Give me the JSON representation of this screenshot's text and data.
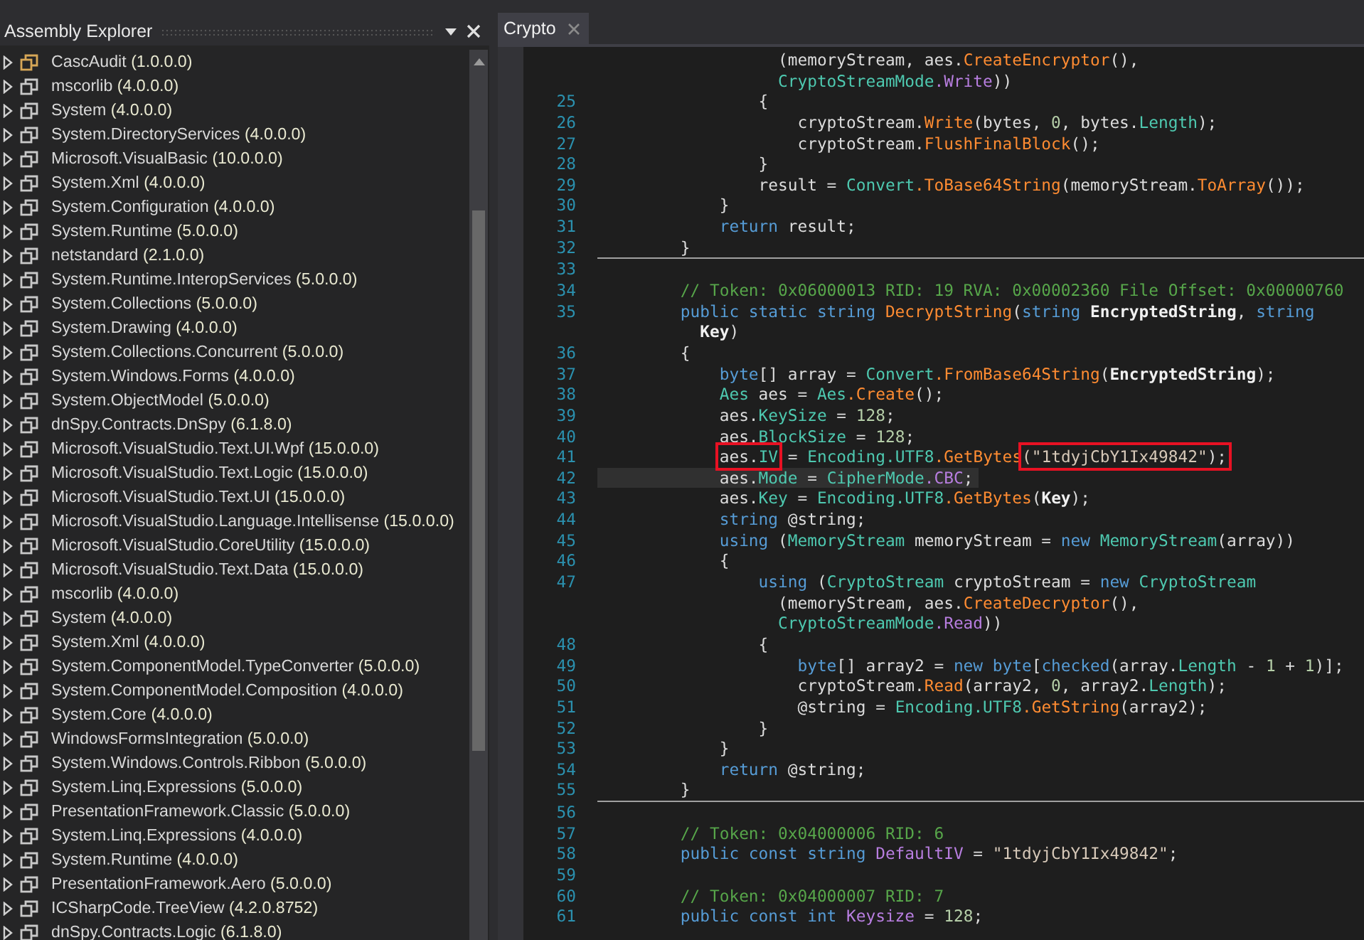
{
  "explorer": {
    "title": "Assembly Explorer",
    "items": [
      {
        "name": "CascAudit",
        "version": "(1.0.0.0)",
        "color": "#d7a757"
      },
      {
        "name": "mscorlib",
        "version": "(4.0.0.0)",
        "color": "#c8c8c8"
      },
      {
        "name": "System",
        "version": "(4.0.0.0)",
        "color": "#c8c8c8"
      },
      {
        "name": "System.DirectoryServices",
        "version": "(4.0.0.0)",
        "color": "#c8c8c8"
      },
      {
        "name": "Microsoft.VisualBasic",
        "version": "(10.0.0.0)",
        "color": "#c8c8c8"
      },
      {
        "name": "System.Xml",
        "version": "(4.0.0.0)",
        "color": "#c8c8c8"
      },
      {
        "name": "System.Configuration",
        "version": "(4.0.0.0)",
        "color": "#c8c8c8"
      },
      {
        "name": "System.Runtime",
        "version": "(5.0.0.0)",
        "color": "#c8c8c8"
      },
      {
        "name": "netstandard",
        "version": "(2.1.0.0)",
        "color": "#c8c8c8"
      },
      {
        "name": "System.Runtime.InteropServices",
        "version": "(5.0.0.0)",
        "color": "#c8c8c8"
      },
      {
        "name": "System.Collections",
        "version": "(5.0.0.0)",
        "color": "#c8c8c8"
      },
      {
        "name": "System.Drawing",
        "version": "(4.0.0.0)",
        "color": "#c8c8c8"
      },
      {
        "name": "System.Collections.Concurrent",
        "version": "(5.0.0.0)",
        "color": "#c8c8c8"
      },
      {
        "name": "System.Windows.Forms",
        "version": "(4.0.0.0)",
        "color": "#c8c8c8"
      },
      {
        "name": "System.ObjectModel",
        "version": "(5.0.0.0)",
        "color": "#c8c8c8"
      },
      {
        "name": "dnSpy.Contracts.DnSpy",
        "version": "(6.1.8.0)",
        "color": "#c8c8c8"
      },
      {
        "name": "Microsoft.VisualStudio.Text.UI.Wpf",
        "version": "(15.0.0.0)",
        "color": "#c8c8c8"
      },
      {
        "name": "Microsoft.VisualStudio.Text.Logic",
        "version": "(15.0.0.0)",
        "color": "#c8c8c8"
      },
      {
        "name": "Microsoft.VisualStudio.Text.UI",
        "version": "(15.0.0.0)",
        "color": "#c8c8c8"
      },
      {
        "name": "Microsoft.VisualStudio.Language.Intellisense",
        "version": "(15.0.0.0)",
        "color": "#c8c8c8"
      },
      {
        "name": "Microsoft.VisualStudio.CoreUtility",
        "version": "(15.0.0.0)",
        "color": "#c8c8c8"
      },
      {
        "name": "Microsoft.VisualStudio.Text.Data",
        "version": "(15.0.0.0)",
        "color": "#c8c8c8"
      },
      {
        "name": "mscorlib",
        "version": "(4.0.0.0)",
        "color": "#c8c8c8"
      },
      {
        "name": "System",
        "version": "(4.0.0.0)",
        "color": "#c8c8c8"
      },
      {
        "name": "System.Xml",
        "version": "(4.0.0.0)",
        "color": "#c8c8c8"
      },
      {
        "name": "System.ComponentModel.TypeConverter",
        "version": "(5.0.0.0)",
        "color": "#c8c8c8"
      },
      {
        "name": "System.ComponentModel.Composition",
        "version": "(4.0.0.0)",
        "color": "#c8c8c8"
      },
      {
        "name": "System.Core",
        "version": "(4.0.0.0)",
        "color": "#c8c8c8"
      },
      {
        "name": "WindowsFormsIntegration",
        "version": "(5.0.0.0)",
        "color": "#c8c8c8"
      },
      {
        "name": "System.Windows.Controls.Ribbon",
        "version": "(5.0.0.0)",
        "color": "#c8c8c8"
      },
      {
        "name": "System.Linq.Expressions",
        "version": "(5.0.0.0)",
        "color": "#c8c8c8"
      },
      {
        "name": "PresentationFramework.Classic",
        "version": "(5.0.0.0)",
        "color": "#c8c8c8"
      },
      {
        "name": "System.Linq.Expressions",
        "version": "(4.0.0.0)",
        "color": "#c8c8c8"
      },
      {
        "name": "System.Runtime",
        "version": "(4.0.0.0)",
        "color": "#c8c8c8"
      },
      {
        "name": "PresentationFramework.Aero",
        "version": "(5.0.0.0)",
        "color": "#c8c8c8"
      },
      {
        "name": "ICSharpCode.TreeView",
        "version": "(4.2.0.8752)",
        "color": "#c8c8c8"
      },
      {
        "name": "dnSpy.Contracts.Logic",
        "version": "(6.1.8.0)",
        "color": "#c8c8c8"
      }
    ]
  },
  "tabs": [
    {
      "label": "Crypto",
      "selected": true
    }
  ],
  "code": {
    "lines": [
      {
        "kind": "code",
        "current": false,
        "tokens": [
          {
            "t": "              (memoryStream, aes.",
            "kind": "plain"
          },
          {
            "t": "CreateEncryptor",
            "kind": "method"
          },
          {
            "t": "(),",
            "kind": "plain"
          }
        ]
      },
      {
        "kind": "code",
        "current": false,
        "tokens": [
          {
            "t": "              CryptoStreamMode",
            "kind": "type"
          },
          {
            "t": ".Write",
            "kind": "member"
          },
          {
            "t": "))",
            "kind": "plain"
          }
        ]
      },
      {
        "kind": "code",
        "number": "25",
        "current": false,
        "tokens": [
          {
            "t": "            {",
            "kind": "plain"
          }
        ]
      },
      {
        "kind": "code",
        "number": "26",
        "current": false,
        "tokens": [
          {
            "t": "                cryptoStream.",
            "kind": "plain"
          },
          {
            "t": "Write",
            "kind": "method"
          },
          {
            "t": "(bytes, ",
            "kind": "plain"
          },
          {
            "t": "0",
            "kind": "number"
          },
          {
            "t": ", bytes.",
            "kind": "plain"
          },
          {
            "t": "Length",
            "kind": "property"
          },
          {
            "t": ");",
            "kind": "plain"
          }
        ]
      },
      {
        "kind": "code",
        "number": "27",
        "current": false,
        "tokens": [
          {
            "t": "                cryptoStream.",
            "kind": "plain"
          },
          {
            "t": "FlushFinalBlock",
            "kind": "method"
          },
          {
            "t": "();",
            "kind": "plain"
          }
        ]
      },
      {
        "kind": "code",
        "number": "28",
        "current": false,
        "tokens": [
          {
            "t": "            }",
            "kind": "plain"
          }
        ]
      },
      {
        "kind": "code",
        "number": "29",
        "current": false,
        "tokens": [
          {
            "t": "            result = ",
            "kind": "plain"
          },
          {
            "t": "Convert",
            "kind": "type"
          },
          {
            "t": ".ToBase64String",
            "kind": "method"
          },
          {
            "t": "(memoryStream.",
            "kind": "plain"
          },
          {
            "t": "ToArray",
            "kind": "method"
          },
          {
            "t": "());",
            "kind": "plain"
          }
        ]
      },
      {
        "kind": "code",
        "number": "30",
        "current": false,
        "tokens": [
          {
            "t": "        }",
            "kind": "plain"
          }
        ]
      },
      {
        "kind": "code",
        "number": "31",
        "current": false,
        "tokens": [
          {
            "t": "        return",
            "kind": "keyword"
          },
          {
            "t": " result;",
            "kind": "plain"
          }
        ]
      },
      {
        "kind": "code",
        "number": "32",
        "current": false,
        "tokens": [
          {
            "t": "    }",
            "kind": "plain"
          }
        ]
      },
      {
        "kind": "separator"
      },
      {
        "kind": "code",
        "number": "33",
        "current": false
      },
      {
        "kind": "code",
        "number": "34",
        "current": false,
        "tokens": [
          {
            "t": "    // Token: 0x06000013 RID: 19 RVA: 0x00002360 File Offset: 0x00000760",
            "kind": "comment"
          }
        ]
      },
      {
        "kind": "code",
        "number": "35",
        "current": false,
        "tokens": [
          {
            "t": "    public static string ",
            "kind": "keyword"
          },
          {
            "t": "DecryptString",
            "kind": "method"
          },
          {
            "t": "(",
            "kind": "plain"
          },
          {
            "t": "string ",
            "kind": "keyword"
          },
          {
            "t": "EncryptedString",
            "kind": "parameter"
          },
          {
            "t": ", ",
            "kind": "plain"
          },
          {
            "t": "string",
            "kind": "keyword"
          }
        ]
      },
      {
        "kind": "code",
        "current": false,
        "tokens": [
          {
            "t": "      Key",
            "kind": "parameter"
          },
          {
            "t": ")",
            "kind": "plain"
          }
        ]
      },
      {
        "kind": "code",
        "number": "36",
        "current": false,
        "tokens": [
          {
            "t": "    {",
            "kind": "plain"
          }
        ]
      },
      {
        "kind": "code",
        "number": "37",
        "current": false,
        "tokens": [
          {
            "t": "        byte",
            "kind": "keyword"
          },
          {
            "t": "[] array = ",
            "kind": "plain"
          },
          {
            "t": "Convert",
            "kind": "type"
          },
          {
            "t": ".FromBase64String",
            "kind": "method"
          },
          {
            "t": "(",
            "kind": "plain"
          },
          {
            "t": "EncryptedString",
            "kind": "parameter"
          },
          {
            "t": ");",
            "kind": "plain"
          }
        ]
      },
      {
        "kind": "code",
        "number": "38",
        "current": false,
        "tokens": [
          {
            "t": "        Aes",
            "kind": "type"
          },
          {
            "t": " aes = ",
            "kind": "plain"
          },
          {
            "t": "Aes",
            "kind": "type"
          },
          {
            "t": ".Create",
            "kind": "method"
          },
          {
            "t": "();",
            "kind": "plain"
          }
        ]
      },
      {
        "kind": "code",
        "number": "39",
        "current": false,
        "tokens": [
          {
            "t": "        aes.",
            "kind": "plain"
          },
          {
            "t": "KeySize",
            "kind": "property"
          },
          {
            "t": " = ",
            "kind": "plain"
          },
          {
            "t": "128",
            "kind": "number"
          },
          {
            "t": ";",
            "kind": "plain"
          }
        ]
      },
      {
        "kind": "code",
        "number": "40",
        "current": false,
        "tokens": [
          {
            "t": "        aes.",
            "kind": "plain"
          },
          {
            "t": "BlockSize",
            "kind": "property"
          },
          {
            "t": " = ",
            "kind": "plain"
          },
          {
            "t": "128",
            "kind": "number"
          },
          {
            "t": ";",
            "kind": "plain"
          }
        ]
      },
      {
        "kind": "code",
        "number": "41",
        "current": false,
        "tokens": [
          {
            "kind": "box",
            "tokens": [
              {
                "t": "        aes.",
                "kind": "plain"
              },
              {
                "t": "IV",
                "kind": "property"
              }
            ]
          },
          {
            "t": " = ",
            "kind": "plain"
          },
          {
            "t": "Encoding",
            "kind": "type"
          },
          {
            "t": ".UTF8",
            "kind": "property"
          },
          {
            "t": ".GetBytes",
            "kind": "method"
          },
          {
            "kind": "box",
            "tokens": [
              {
                "t": "(\"1tdyjCbY1Ix49842\"",
                "kind": "string"
              },
              {
                "t": ");",
                "kind": "plain"
              }
            ]
          }
        ]
      },
      {
        "kind": "code",
        "number": "42",
        "current": true,
        "tokens": [
          {
            "t": "        aes.",
            "kind": "plain"
          },
          {
            "t": "Mode",
            "kind": "property"
          },
          {
            "t": " = ",
            "kind": "plain"
          },
          {
            "t": "CipherMode",
            "kind": "type"
          },
          {
            "t": ".CBC",
            "kind": "member"
          },
          {
            "t": ";",
            "kind": "plain"
          }
        ]
      },
      {
        "kind": "code",
        "number": "43",
        "current": false,
        "tokens": [
          {
            "t": "        aes.",
            "kind": "plain"
          },
          {
            "t": "Key",
            "kind": "property"
          },
          {
            "t": " = ",
            "kind": "plain"
          },
          {
            "t": "Encoding",
            "kind": "type"
          },
          {
            "t": ".UTF8",
            "kind": "property"
          },
          {
            "t": ".GetBytes",
            "kind": "method"
          },
          {
            "t": "(",
            "kind": "plain"
          },
          {
            "t": "Key",
            "kind": "parameter"
          },
          {
            "t": ");",
            "kind": "plain"
          }
        ]
      },
      {
        "kind": "code",
        "number": "44",
        "current": false,
        "tokens": [
          {
            "t": "        string",
            "kind": "keyword"
          },
          {
            "t": " @string;",
            "kind": "plain"
          }
        ]
      },
      {
        "kind": "code",
        "number": "45",
        "current": false,
        "tokens": [
          {
            "t": "        using",
            "kind": "keyword"
          },
          {
            "t": " (",
            "kind": "plain"
          },
          {
            "t": "MemoryStream",
            "kind": "type"
          },
          {
            "t": " memoryStream = ",
            "kind": "plain"
          },
          {
            "t": "new ",
            "kind": "keyword"
          },
          {
            "t": "MemoryStream",
            "kind": "type"
          },
          {
            "t": "(array))",
            "kind": "plain"
          }
        ]
      },
      {
        "kind": "code",
        "number": "46",
        "current": false,
        "tokens": [
          {
            "t": "        {",
            "kind": "plain"
          }
        ]
      },
      {
        "kind": "code",
        "number": "47",
        "current": false,
        "tokens": [
          {
            "t": "            using",
            "kind": "keyword"
          },
          {
            "t": " (",
            "kind": "plain"
          },
          {
            "t": "CryptoStream",
            "kind": "type"
          },
          {
            "t": " cryptoStream = ",
            "kind": "plain"
          },
          {
            "t": "new ",
            "kind": "keyword"
          },
          {
            "t": "CryptoStream",
            "kind": "type"
          }
        ]
      },
      {
        "kind": "code",
        "current": false,
        "tokens": [
          {
            "t": "              (memoryStream, aes.",
            "kind": "plain"
          },
          {
            "t": "CreateDecryptor",
            "kind": "method"
          },
          {
            "t": "(),",
            "kind": "plain"
          }
        ]
      },
      {
        "kind": "code",
        "current": false,
        "tokens": [
          {
            "t": "              CryptoStreamMode",
            "kind": "type"
          },
          {
            "t": ".Read",
            "kind": "member"
          },
          {
            "t": "))",
            "kind": "plain"
          }
        ]
      },
      {
        "kind": "code",
        "number": "48",
        "current": false,
        "tokens": [
          {
            "t": "            {",
            "kind": "plain"
          }
        ]
      },
      {
        "kind": "code",
        "number": "49",
        "current": false,
        "tokens": [
          {
            "t": "                byte",
            "kind": "keyword"
          },
          {
            "t": "[] array2 = ",
            "kind": "plain"
          },
          {
            "t": "new byte",
            "kind": "keyword"
          },
          {
            "t": "[",
            "kind": "plain"
          },
          {
            "t": "checked",
            "kind": "keyword"
          },
          {
            "t": "(array.",
            "kind": "plain"
          },
          {
            "t": "Length",
            "kind": "property"
          },
          {
            "t": " - ",
            "kind": "plain"
          },
          {
            "t": "1",
            "kind": "number"
          },
          {
            "t": " + ",
            "kind": "plain"
          },
          {
            "t": "1",
            "kind": "number"
          },
          {
            "t": ")];",
            "kind": "plain"
          }
        ]
      },
      {
        "kind": "code",
        "number": "50",
        "current": false,
        "tokens": [
          {
            "t": "                cryptoStream.",
            "kind": "plain"
          },
          {
            "t": "Read",
            "kind": "method"
          },
          {
            "t": "(array2, ",
            "kind": "plain"
          },
          {
            "t": "0",
            "kind": "number"
          },
          {
            "t": ", array2.",
            "kind": "plain"
          },
          {
            "t": "Length",
            "kind": "property"
          },
          {
            "t": ");",
            "kind": "plain"
          }
        ]
      },
      {
        "kind": "code",
        "number": "51",
        "current": false,
        "tokens": [
          {
            "t": "                @string = ",
            "kind": "plain"
          },
          {
            "t": "Encoding",
            "kind": "type"
          },
          {
            "t": ".UTF8",
            "kind": "property"
          },
          {
            "t": ".GetString",
            "kind": "method"
          },
          {
            "t": "(array2);",
            "kind": "plain"
          }
        ]
      },
      {
        "kind": "code",
        "number": "52",
        "current": false,
        "tokens": [
          {
            "t": "            }",
            "kind": "plain"
          }
        ]
      },
      {
        "kind": "code",
        "number": "53",
        "current": false,
        "tokens": [
          {
            "t": "        }",
            "kind": "plain"
          }
        ]
      },
      {
        "kind": "code",
        "number": "54",
        "current": false,
        "tokens": [
          {
            "t": "        return",
            "kind": "keyword"
          },
          {
            "t": " @string;",
            "kind": "plain"
          }
        ]
      },
      {
        "kind": "code",
        "number": "55",
        "current": false,
        "tokens": [
          {
            "t": "    }",
            "kind": "plain"
          }
        ]
      },
      {
        "kind": "separator"
      },
      {
        "kind": "code",
        "number": "56",
        "current": false
      },
      {
        "kind": "code",
        "number": "57",
        "current": false,
        "tokens": [
          {
            "t": "    // Token: 0x04000006 RID: 6",
            "kind": "comment"
          }
        ]
      },
      {
        "kind": "code",
        "number": "58",
        "current": false,
        "tokens": [
          {
            "t": "    public const string ",
            "kind": "keyword"
          },
          {
            "t": "DefaultIV",
            "kind": "member"
          },
          {
            "t": " = ",
            "kind": "plain"
          },
          {
            "t": "\"1tdyjCbY1Ix49842\"",
            "kind": "string"
          },
          {
            "t": ";",
            "kind": "plain"
          }
        ]
      },
      {
        "kind": "code",
        "number": "59",
        "current": false
      },
      {
        "kind": "code",
        "number": "60",
        "current": false,
        "tokens": [
          {
            "t": "    // Token: 0x04000007 RID: 7",
            "kind": "comment"
          }
        ]
      },
      {
        "kind": "code",
        "number": "61",
        "current": false,
        "tokens": [
          {
            "t": "    public const int ",
            "kind": "keyword"
          },
          {
            "t": "Keysize",
            "kind": "member"
          },
          {
            "t": " = ",
            "kind": "plain"
          },
          {
            "t": "128",
            "kind": "number"
          },
          {
            "t": ";",
            "kind": "plain"
          }
        ]
      }
    ]
  }
}
